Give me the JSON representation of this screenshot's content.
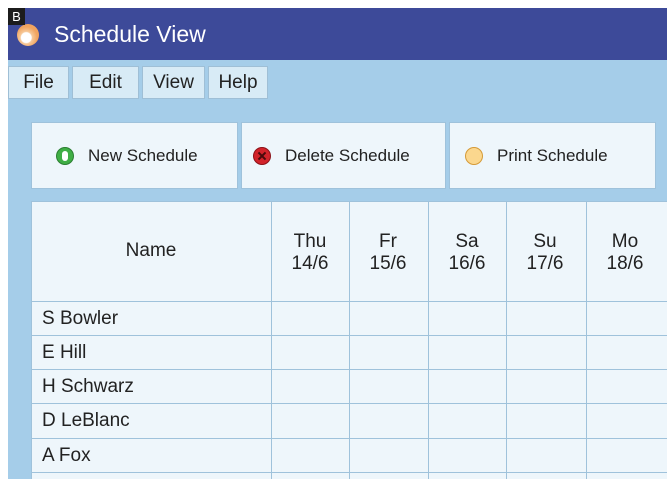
{
  "badge": "B",
  "window": {
    "title": "Schedule View"
  },
  "menu": [
    "File",
    "Edit",
    "View",
    "Help"
  ],
  "toolbar": {
    "new_label": "New Schedule",
    "delete_label": "Delete Schedule",
    "print_label": "Print Schedule"
  },
  "table": {
    "name_header": "Name",
    "days": [
      {
        "day": "Thu",
        "date": "14/6"
      },
      {
        "day": "Fr",
        "date": "15/6"
      },
      {
        "day": "Sa",
        "date": "16/6"
      },
      {
        "day": "Su",
        "date": "17/6"
      },
      {
        "day": "Mo",
        "date": "18/6"
      }
    ],
    "rows": [
      "S Bowler",
      "E Hill",
      "H Schwarz",
      "D LeBlanc",
      "A Fox"
    ]
  },
  "colors": {
    "titlebar": "#3d4a99",
    "background": "#a5cde9",
    "panel": "#eef6fb",
    "border": "#9fc2db",
    "new_icon": "#3fae45",
    "delete_icon": "#d2232a",
    "print_icon": "#fbd78e"
  },
  "icons": {
    "app": "app-logo-icon",
    "new": "new-schedule-icon",
    "delete": "delete-icon",
    "print": "print-icon"
  }
}
